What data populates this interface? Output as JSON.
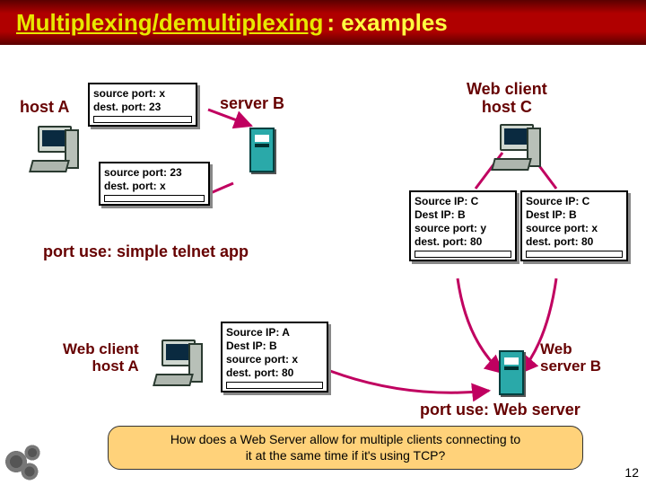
{
  "title": {
    "underlined": "Multiplexing/demultiplexing",
    "rest": ": examples"
  },
  "labels": {
    "hostA": "host A",
    "serverB": "server B",
    "webClientC_l1": "Web client",
    "webClientC_l2": "host C",
    "webClientA_l1": "Web client",
    "webClientA_l2": "host A",
    "webServerB_l1": "Web",
    "webServerB_l2": "server B"
  },
  "captions": {
    "telnet": "port use: simple telnet app",
    "webserver": "port use: Web server"
  },
  "boxes": {
    "hostA_out": {
      "l1": "source port: x",
      "l2": "dest. port: 23"
    },
    "hostA_in": {
      "l1": "source port: 23",
      "l2": "dest. port: x"
    },
    "c_left": {
      "l1": "Source IP: C",
      "l2": "Dest IP: B",
      "l3": "source port: y",
      "l4": "dest. port: 80"
    },
    "c_right": {
      "l1": "Source IP: C",
      "l2": "Dest IP: B",
      "l3": "source port: x",
      "l4": "dest. port: 80"
    },
    "a_web": {
      "l1": "Source IP: A",
      "l2": "Dest IP: B",
      "l3": "source port: x",
      "l4": "dest. port: 80"
    }
  },
  "note": {
    "l1": "How does a Web Server allow for multiple clients connecting to",
    "l2": "it at the same time if it's using TCP?"
  },
  "pagenum": "12"
}
